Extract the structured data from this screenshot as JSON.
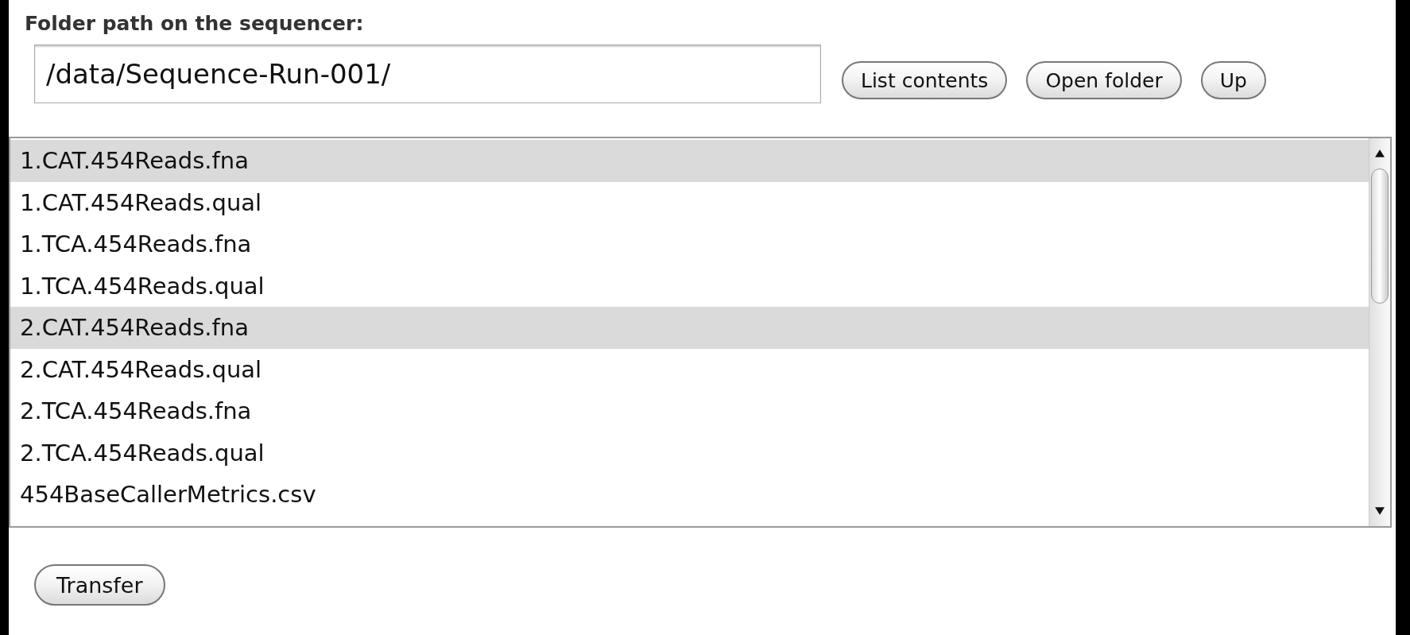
{
  "folder_label": "Folder path on the sequencer:",
  "path_field": {
    "value": "/data/Sequence-Run-001/"
  },
  "buttons": [
    "List contents",
    "Open folder",
    "Up"
  ],
  "files": [
    {
      "name": "1.CAT.454Reads.fna",
      "selected": true
    },
    {
      "name": "1.CAT.454Reads.qual",
      "selected": false
    },
    {
      "name": "1.TCA.454Reads.fna",
      "selected": false
    },
    {
      "name": "1.TCA.454Reads.qual",
      "selected": false
    },
    {
      "name": "2.CAT.454Reads.fna",
      "selected": true
    },
    {
      "name": "2.CAT.454Reads.qual",
      "selected": false
    },
    {
      "name": "2.TCA.454Reads.fna",
      "selected": false
    },
    {
      "name": "2.TCA.454Reads.qual",
      "selected": false
    },
    {
      "name": "454BaseCallerMetrics.csv",
      "selected": false
    }
  ],
  "transfer_button": "Transfer"
}
